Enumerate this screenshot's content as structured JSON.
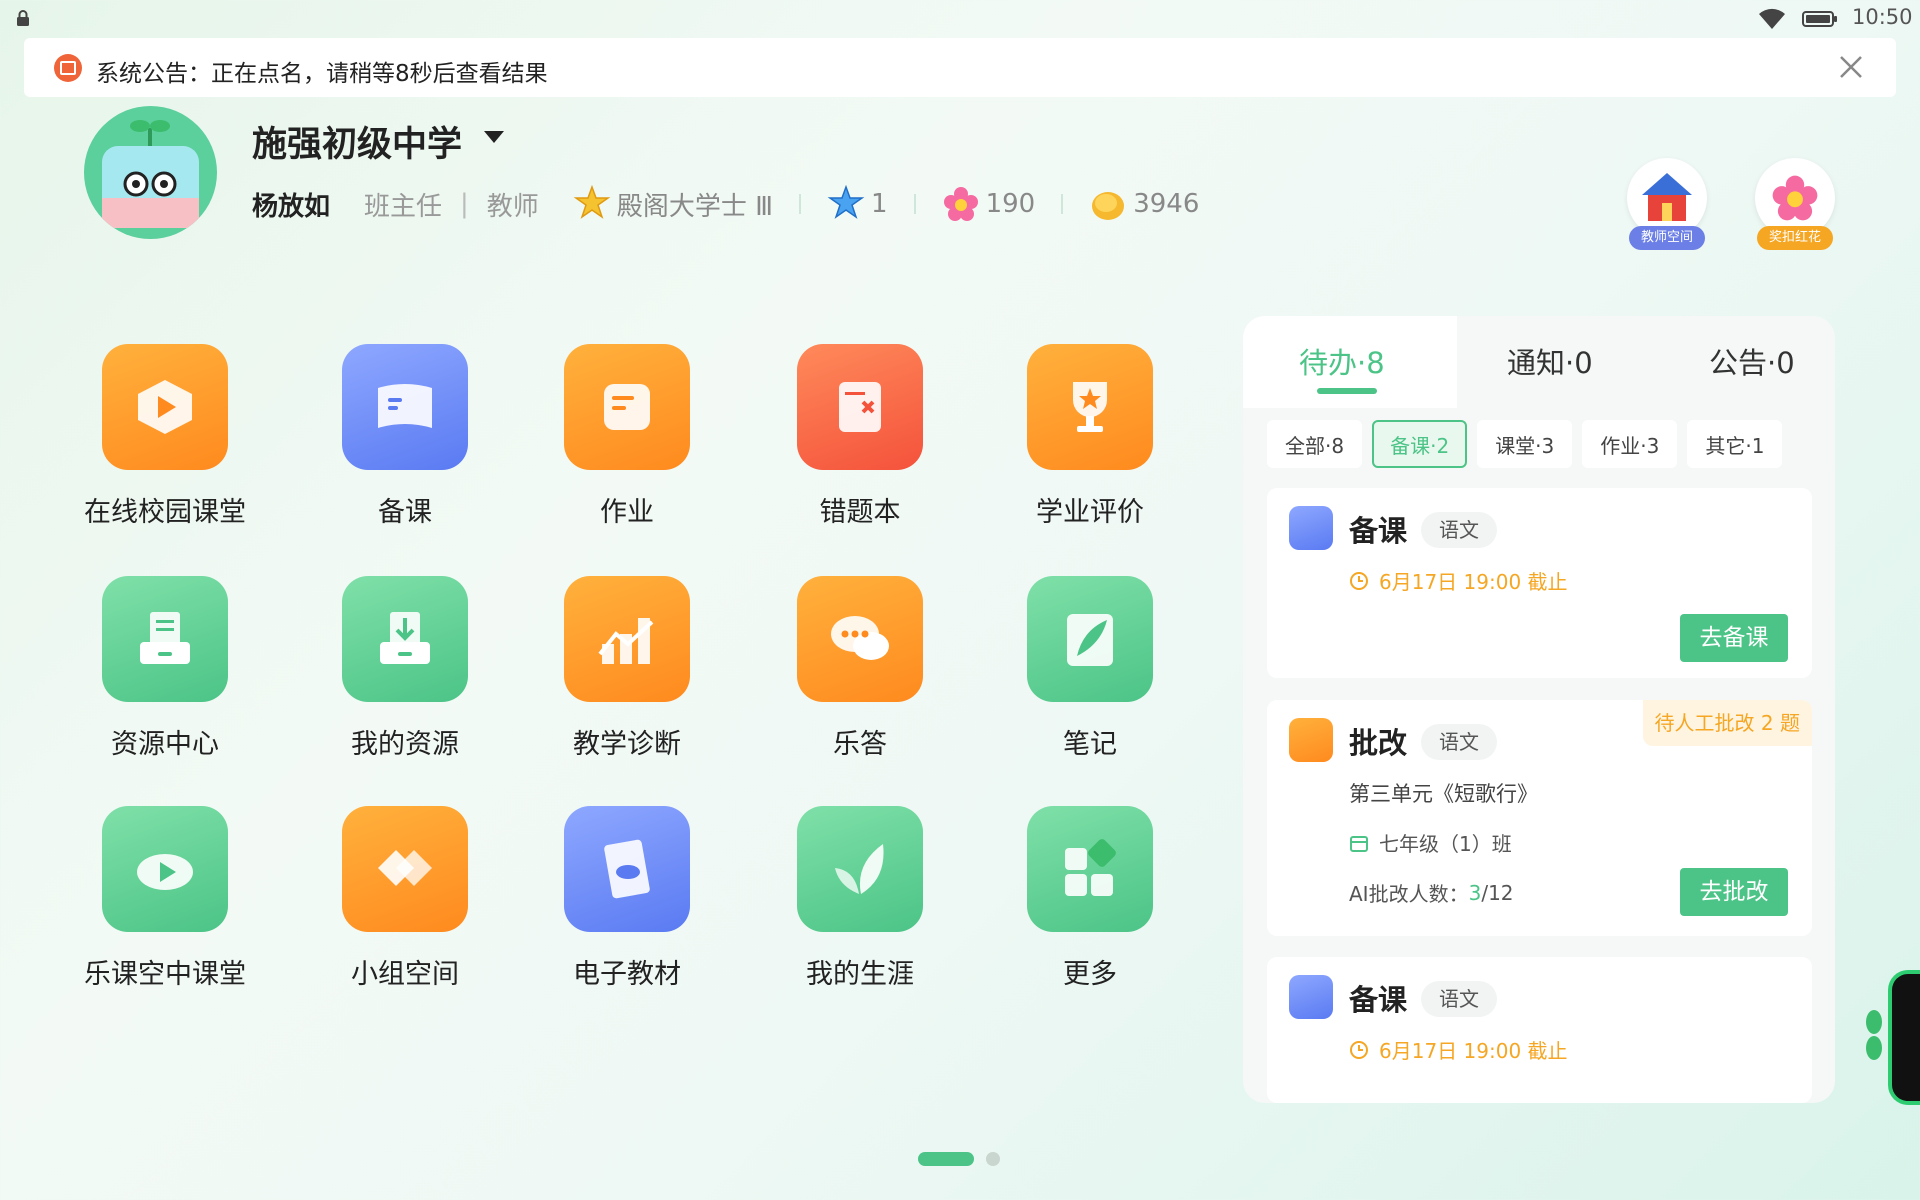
{
  "status_bar": {
    "time": "10:50"
  },
  "announcement": {
    "text": "系统公告：正在点名，请稍等8秒后查看结果"
  },
  "profile": {
    "school": "施强初级中学",
    "user_name": "杨放如",
    "role_primary": "班主任",
    "role_separator": "|",
    "role_secondary": "教师",
    "rank_title": "殿阁大学士 Ⅲ",
    "le_count": "1",
    "flower_count": "190",
    "coin_count": "3946"
  },
  "top_buttons": {
    "teacher_space": "教师空间",
    "reward_flower": "奖扣红花"
  },
  "apps": [
    {
      "label": "在线校园课堂",
      "icon": "play-video-icon",
      "color": "orange"
    },
    {
      "label": "备课",
      "icon": "lesson-book-icon",
      "color": "blue"
    },
    {
      "label": "作业",
      "icon": "homework-edit-icon",
      "color": "orange"
    },
    {
      "label": "错题本",
      "icon": "wrong-notebook-icon",
      "color": "red"
    },
    {
      "label": "学业评价",
      "icon": "trophy-icon",
      "color": "orange"
    },
    {
      "label": "资源中心",
      "icon": "resource-tray-icon",
      "color": "green"
    },
    {
      "label": "我的资源",
      "icon": "download-tray-icon",
      "color": "green"
    },
    {
      "label": "教学诊断",
      "icon": "chart-bars-icon",
      "color": "orange"
    },
    {
      "label": "乐答",
      "icon": "chat-bubble-icon",
      "color": "orange"
    },
    {
      "label": "笔记",
      "icon": "feather-note-icon",
      "color": "green"
    },
    {
      "label": "乐课空中课堂",
      "icon": "play-cloud-icon",
      "color": "green"
    },
    {
      "label": "小组空间",
      "icon": "handshake-icon",
      "color": "orange"
    },
    {
      "label": "电子教材",
      "icon": "ebook-icon",
      "color": "blue"
    },
    {
      "label": "我的生涯",
      "icon": "leaf-sprout-icon",
      "color": "green"
    },
    {
      "label": "更多",
      "icon": "more-blocks-icon",
      "color": "green"
    }
  ],
  "panel": {
    "tabs": [
      "待办·8",
      "通知·0",
      "公告·0"
    ],
    "chips": [
      "全部·8",
      "备课·2",
      "课堂·3",
      "作业·3",
      "其它·1"
    ],
    "cards": [
      {
        "title": "备课",
        "subject": "语文",
        "deadline": "6月17日 19:00 截止",
        "action": "去备课"
      },
      {
        "title": "批改",
        "subject": "语文",
        "badge": "待人工批改 2 题",
        "unit": "第三单元《短歌行》",
        "class_name": "七年级（1）班",
        "ai_label": "AI批改人数：",
        "ai_done": "3",
        "ai_total": "/12",
        "action": "去批改"
      },
      {
        "title": "备课",
        "subject": "语文",
        "deadline": "6月17日 19:00 截止"
      }
    ]
  },
  "colors": {
    "accent_green": "#4cc487",
    "warning_orange": "#f5a623",
    "alert_red": "#f0643a"
  }
}
